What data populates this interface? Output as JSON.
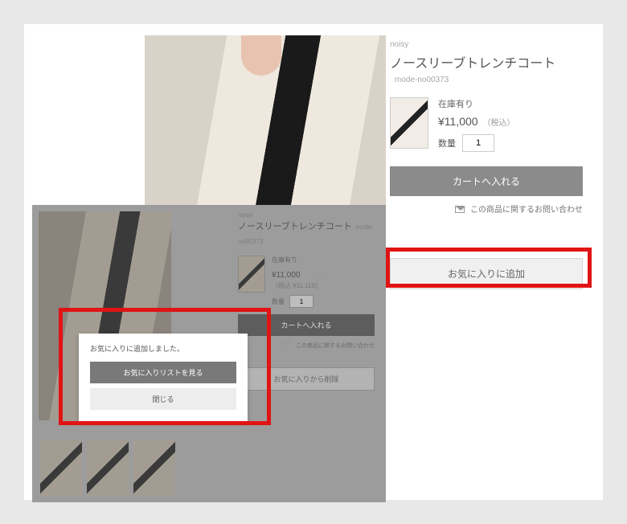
{
  "main": {
    "brand": "noisy",
    "title": "ノースリーブトレンチコート",
    "sku": "mode-no00373",
    "stock_label": "在庫有り",
    "price": "¥11,000",
    "tax_label": "（税込）",
    "qty_label": "数量",
    "qty_value": "1",
    "add_to_cart": "カートへ入れる",
    "contact": "この商品に関するお問い合わせ",
    "add_to_fav": "お気に入りに追加"
  },
  "overlay": {
    "brand": "noisy",
    "title": "ノースリーブトレンチコート",
    "sku": "mode-no00373",
    "stock_label": "在庫有り",
    "price": "¥11,000",
    "tax_label": "（税込）",
    "tax_incl_line": "（税込 ¥11,110）",
    "qty_label": "数量",
    "qty_value": "1",
    "add_to_cart": "カートへ入れる",
    "contact": "この商品に関するお問い合わせ",
    "remove_fav": "お気に入りから削除"
  },
  "modal": {
    "message": "お気に入りに追加しました。",
    "view_list": "お気に入りリストを見る",
    "close": "閉じる"
  }
}
